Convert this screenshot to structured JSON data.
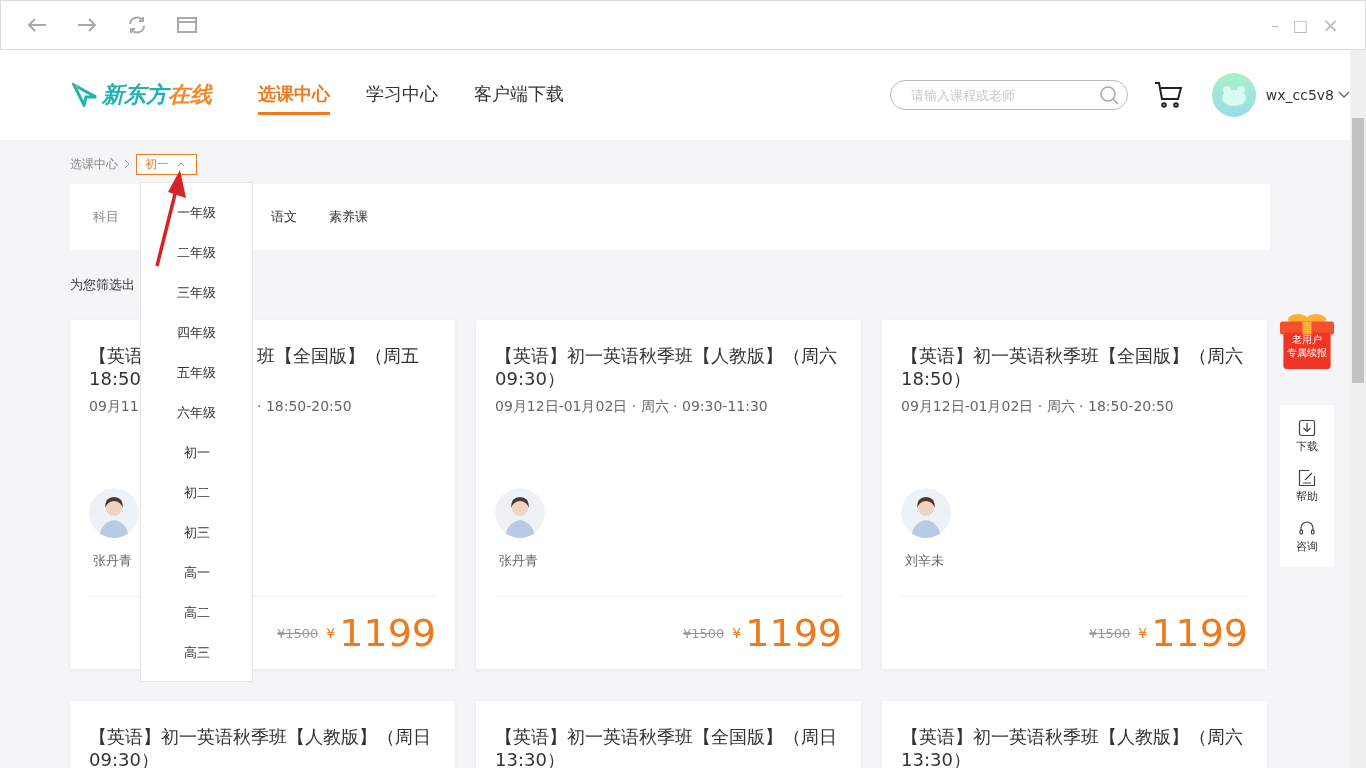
{
  "window_controls": {
    "minimize": "–",
    "maximize": "□",
    "close": "×"
  },
  "header": {
    "logo": {
      "text_main": "新东方",
      "text_accent": "在线"
    },
    "nav": [
      {
        "label": "选课中心",
        "selected": true
      },
      {
        "label": "学习中心",
        "selected": false
      },
      {
        "label": "客户端下载",
        "selected": false
      }
    ],
    "search": {
      "placeholder": "请输入课程或老师"
    },
    "user": {
      "name": "wx_cc5v8"
    }
  },
  "breadcrumb": {
    "root": "选课中心",
    "current": "初一"
  },
  "filter": {
    "label": "科目",
    "subjects": [
      "语文",
      "素养课"
    ]
  },
  "result_text": "为您筛选出",
  "grade_dropdown": {
    "items": [
      "一年级",
      "二年级",
      "三年级",
      "四年级",
      "五年级",
      "六年级",
      "初一",
      "初二",
      "初三",
      "高一",
      "高二",
      "高三"
    ]
  },
  "cards": [
    {
      "kind": "covered",
      "title_lines": [
        [
          "【英语",
          "班【全国版】（周五"
        ],
        [
          "18:50"
        ]
      ],
      "date_parts": [
        "09月11",
        "· 18:50-20:50"
      ],
      "teacher": "张丹青",
      "old_price": "¥1500",
      "currency": "¥",
      "price": "1199"
    },
    {
      "kind": "full",
      "title": "【英语】初一英语秋季班【人教版】（周六 09:30）",
      "date": "09月12日-01月02日 · 周六 · 09:30-11:30",
      "teacher": "张丹青",
      "old_price": "¥1500",
      "currency": "¥",
      "price": "1199"
    },
    {
      "kind": "full",
      "title": "【英语】初一英语秋季班【全国版】（周六 18:50）",
      "date": "09月12日-01月02日 · 周六 · 18:50-20:50",
      "teacher": "刘辛未",
      "old_price": "¥1500",
      "currency": "¥",
      "price": "1199"
    },
    {
      "kind": "title_only",
      "title": "【英语】初一英语秋季班【人教版】（周日 09:30）"
    },
    {
      "kind": "title_only",
      "title": "【英语】初一英语秋季班【全国版】（周日 13:30）"
    },
    {
      "kind": "title_only",
      "title": "【英语】初一英语秋季班【人教版】（周六 13:30）"
    }
  ],
  "promo_badge": {
    "line1": "老用户",
    "line2": "专属续报"
  },
  "side_tools": [
    {
      "label": "下载"
    },
    {
      "label": "帮助"
    },
    {
      "label": "咨询"
    }
  ]
}
